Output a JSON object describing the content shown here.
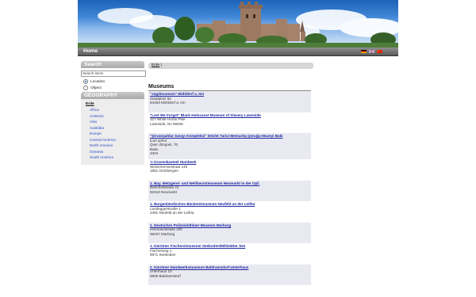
{
  "nav": {
    "home": "Home"
  },
  "languages": [
    {
      "name": "German flag",
      "colors": [
        "#000000",
        "#dd0000",
        "#ffce00"
      ]
    },
    {
      "name": "English flag",
      "colors": [
        "#1a3c8f",
        "#cf142b",
        "#ffffff"
      ]
    },
    {
      "name": "Chinese flag",
      "colors": [
        "#de2910",
        "#de2910",
        "#ffde00"
      ]
    }
  ],
  "sidebar": {
    "search_heading": "Search",
    "search_placeholder": "Search items",
    "options": [
      {
        "label": "Location",
        "selected": true
      },
      {
        "label": "Object",
        "selected": false
      }
    ],
    "geo_heading": "GEOGRAPHY",
    "geo_root": "Erde",
    "geo_items": [
      "Africa",
      "Antarctic",
      "Asia",
      "Australia",
      "Europe",
      "Central America",
      "North America",
      "Oceania",
      "South America"
    ]
  },
  "breadcrumb": "Erde",
  "breadcrumb_sep": "|",
  "main": {
    "title": "Museums",
    "items": [
      {
        "name": "\"Jagdmuseum\" Mühldorf a. Inn",
        "lines": [
          "Stadtplatz 82",
          "84453 Mühldorf a. Inn"
        ]
      },
      {
        "name": "\"Lest We Forget\" Black Holocaust Museum of Slavery Lawnside",
        "lines": [
          "327 White Horse Pike",
          "Lawnside, NJ 08045"
        ]
      },
      {
        "name": "\"Şirvanşahlar Sarayı Kompleksi\" Dövlət Tarixi-Memarlıq Qoruğu-Muzeyi Baki",
        "lines": [
          "İçəri şəhər",
          "Qəsr döngəsi, 76",
          "Baku",
          "1004"
        ]
      },
      {
        "name": "'s Gravenkasteel Humbeek",
        "lines": [
          "Wolvertemsestraat 145",
          "1851 Grimbergen"
        ]
      },
      {
        "name": "1. Bay. Metzgerei- und Weißwurstmuseum Neumarkt in der Opf.",
        "lines": [
          "Bahnhofstraße 21",
          "92318 Neumarkt"
        ]
      },
      {
        "name": "1. Burgenländisches Bäckereimuseum Neufeld an der Leitha",
        "lines": [
          "Landeggerstraße 1",
          "2491 Neufeld an der Leitha"
        ]
      },
      {
        "name": "1. Deutsches Polizeioldtimer-Museum Marburg",
        "lines": [
          "Hermannstraße 200",
          "35037 Marburg"
        ]
      },
      {
        "name": "1. Kärntner Fischereimuseum Seeboden/Millstätter See",
        "lines": [
          "Fischerweg 1",
          "9871 Seeboden"
        ]
      },
      {
        "name": "1. Kärntner Handwerksmuseum Baldramsdorf-Unterhaus",
        "lines": [
          "Unterhaus 10",
          "9805 Baldramsdorf"
        ]
      }
    ]
  }
}
